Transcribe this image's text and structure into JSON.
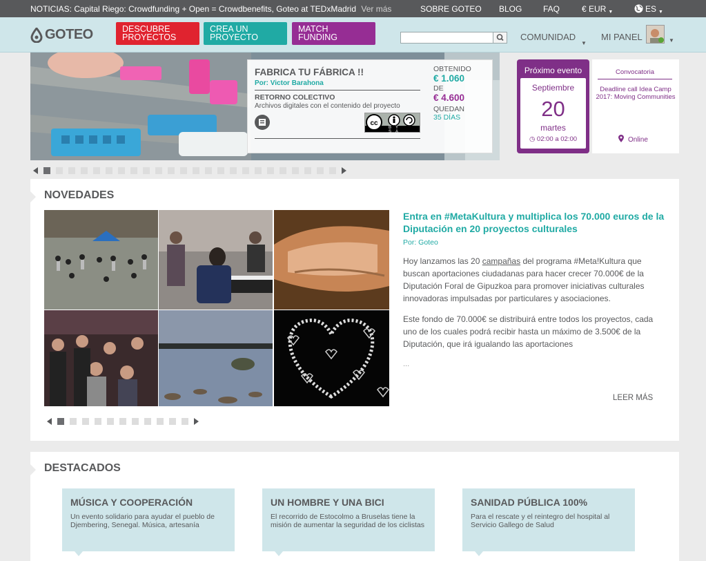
{
  "topbar": {
    "news_label": "NOTICIAS:",
    "news_text": "Capital Riego: Crowdfunding + Open = Crowdbenefits, Goteo at TEDxMadrid",
    "news_more": "Ver más",
    "links": {
      "sobre": "SOBRE GOTEO",
      "blog": "BLOG",
      "faq": "FAQ",
      "currency": "€ EUR",
      "language": "ES"
    }
  },
  "header": {
    "logo": "GOTEO",
    "buttons": {
      "descubre": "DESCUBRE PROYECTOS",
      "crea": "CREA UN PROYECTO",
      "match": "MATCH FUNDING"
    },
    "search_placeholder": "",
    "comunidad": "COMUNIDAD",
    "mipanel": "MI PANEL"
  },
  "hero": {
    "title": "FABRICA TU FÁBRICA !!",
    "by": "Por: Victor Barahona",
    "return_label": "RETORNO COLECTIVO",
    "return_desc": "Archivos digitales con el contenido del proyecto",
    "license": "BY SA",
    "obtenido_label": "OBTENIDO",
    "obtenido": "€ 1.060",
    "de_label": "DE",
    "goal": "€ 4.600",
    "quedan_label": "QUEDAN",
    "days": "35 DÍAS"
  },
  "event": {
    "heading": "Próximo evento",
    "month": "Septiembre",
    "day": "20",
    "weekday": "martes",
    "time": "02:00 a 02:00"
  },
  "convocatoria": {
    "label": "Convocatoria",
    "text": "Deadline call Idea Camp 2017: Moving Communities",
    "location": "Online"
  },
  "hero_slider": {
    "count": 24,
    "active": 0
  },
  "novedades": {
    "title": "NOVEDADES",
    "headline": "Entra en #MetaKultura y multiplica los 70.000 euros de la Diputación en 20 proyectos culturales",
    "by": "Por: Goteo",
    "p1_before": "Hoy lanzamos las 20 ",
    "p1_link": "campañas",
    "p1_after": " del programa #Meta!Kultura que buscan aportaciones ciudadanas para hacer crecer 70.000€ de la Diputación Foral de Gipuzkoa para promover iniciativas culturales innovadoras impulsadas por particulares y asociaciones.",
    "p2": "Este fondo de 70.000€ se distribuirá entre todos los proyectos, cada uno de los cuales podrá recibir hasta un máximo de 3.500€ de la Diputación, que irá igualando las aportaciones",
    "ellipsis": "...",
    "read_more": "LEER MÁS",
    "slider": {
      "count": 11,
      "active": 0
    }
  },
  "destacados": {
    "title": "DESTACADOS",
    "cards": [
      {
        "title": "MÚSICA Y COOPERACIÓN",
        "desc": "Un evento solidario para ayudar el pueblo de Djembering, Senegal. Música, artesanía"
      },
      {
        "title": "UN HOMBRE Y UNA BICI",
        "desc": "El recorrido de Estocolmo a Bruselas tiene la misión de aumentar la seguridad de los ciclistas"
      },
      {
        "title": "SANIDAD PÚBLICA 100%",
        "desc": "Para el rescate y el reintegro del hospital al Servicio Gallego de Salud"
      }
    ]
  },
  "colors": {
    "red": "#e0232f",
    "teal": "#20aaa4",
    "purple": "#962d94",
    "event_purple": "#7f2f87",
    "header_bg": "#cfe6ea",
    "topbar_bg": "#58595b"
  }
}
